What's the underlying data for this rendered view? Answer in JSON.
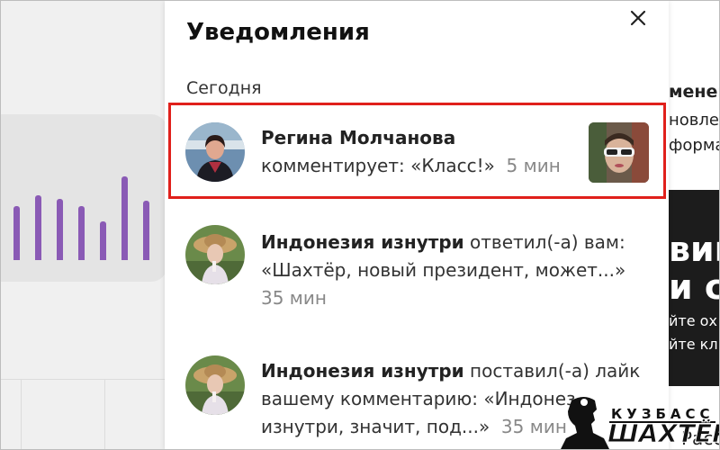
{
  "panel": {
    "title": "Уведомления",
    "section": "Сегодня"
  },
  "notifications": [
    {
      "name": "Регина Молчанова",
      "line1_rest": "",
      "line2": "комментирует: «Класс!»",
      "time": "5 мин",
      "highlighted": true
    },
    {
      "name": "Индонезия изнутри",
      "line1_rest": " ответил(-а) вам:",
      "line2": "«Шахтёр, новый президент, может...»",
      "time": "35 мин"
    },
    {
      "name": "Индонезия изнутри",
      "line1_rest": " поставил(-а) лайк",
      "line2": "вашему комментарию: «Индонез",
      "line3": "изнутри, значит, под...»",
      "time": "35 мин"
    }
  ],
  "background": {
    "right_snippets": [
      "менен",
      "новле",
      "форма"
    ],
    "dark_snippets_big": [
      "виг",
      "и с"
    ],
    "dark_snippets_small": [
      "йте ох",
      "йте кл"
    ],
    "bottom_snippet": "Расс"
  },
  "watermark": {
    "top": "КУЗБАСС",
    "main": "ШАХТЁР"
  },
  "colors": {
    "highlight": "#e0201b",
    "bars": "#8a5ab5"
  }
}
